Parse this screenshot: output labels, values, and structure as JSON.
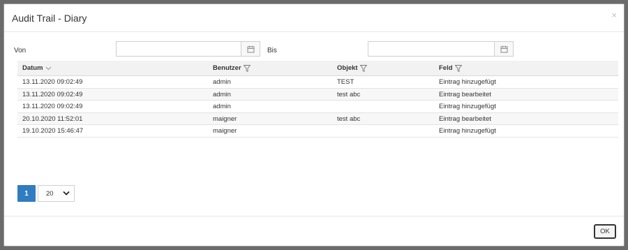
{
  "dialog": {
    "title": "Audit Trail - Diary",
    "close_symbol": "×"
  },
  "filters": {
    "from_label": "Von",
    "from_value": "",
    "to_label": "Bis",
    "to_value": "",
    "calendar_icon": "calendar-icon"
  },
  "table": {
    "columns": [
      {
        "label": "Datum",
        "icon": "chevron-down-icon"
      },
      {
        "label": "Benutzer",
        "icon": "filter-icon"
      },
      {
        "label": "Objekt",
        "icon": "filter-icon"
      },
      {
        "label": "Feld",
        "icon": "filter-icon"
      }
    ],
    "rows": [
      {
        "datum": "13.11.2020 09:02:49",
        "benutzer": "admin",
        "objekt": "TEST",
        "feld": "Eintrag hinzugefügt"
      },
      {
        "datum": "13.11.2020 09:02:49",
        "benutzer": "admin",
        "objekt": "test abc",
        "feld": "Eintrag bearbeitet"
      },
      {
        "datum": "13.11.2020 09:02:49",
        "benutzer": "admin",
        "objekt": "",
        "feld": "Eintrag hinzugefügt"
      },
      {
        "datum": "20.10.2020 11:52:01",
        "benutzer": "maigner",
        "objekt": "test abc",
        "feld": "Eintrag bearbeitet"
      },
      {
        "datum": "19.10.2020 15:46:47",
        "benutzer": "maigner",
        "objekt": "",
        "feld": "Eintrag hinzugefügt"
      }
    ]
  },
  "pagination": {
    "current_page": "1",
    "page_size": "20"
  },
  "footer": {
    "ok_label": "OK"
  },
  "colors": {
    "accent": "#2f7cc1",
    "backdrop": "#6b6b6b"
  }
}
